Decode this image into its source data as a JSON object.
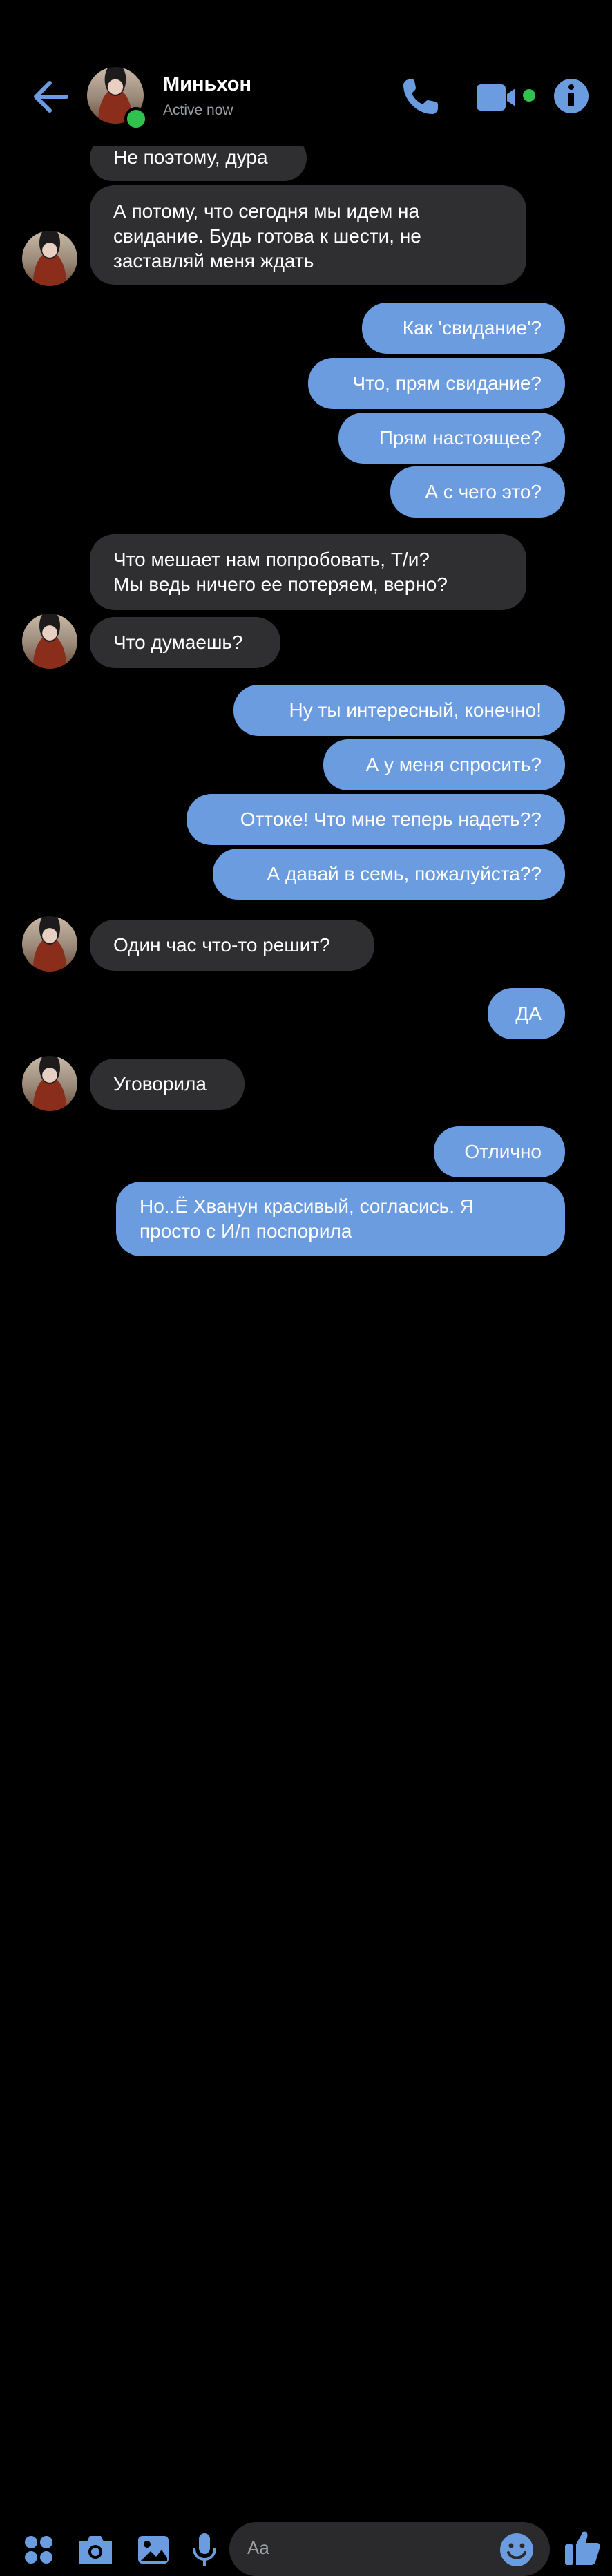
{
  "header": {
    "name": "Миньхон",
    "status": "Active now"
  },
  "messages": [
    {
      "side": "in",
      "text": "Не поэтому, дура"
    },
    {
      "side": "in",
      "text": "А потому, что сегодня мы идем на\nсвидание. Будь готова к шести, не\nзаставляй меня ждать"
    },
    {
      "side": "out",
      "text": "Как 'свидание'?"
    },
    {
      "side": "out",
      "text": "Что, прям свидание?"
    },
    {
      "side": "out",
      "text": "Прям настоящее?"
    },
    {
      "side": "out",
      "text": "А с чего это?"
    },
    {
      "side": "in",
      "text": "Что мешает нам попробовать, Т/и?\nМы ведь ничего ее потеряем, верно?"
    },
    {
      "side": "in",
      "text": "Что думаешь?"
    },
    {
      "side": "out",
      "text": "Ну ты интересный, конечно!"
    },
    {
      "side": "out",
      "text": "А у меня спросить?"
    },
    {
      "side": "out",
      "text": "Оттоке! Что мне теперь надеть??"
    },
    {
      "side": "out",
      "text": "А давай в семь, пожалуйста??"
    },
    {
      "side": "in",
      "text": "Один час что-то решит?"
    },
    {
      "side": "out",
      "text": "ДА"
    },
    {
      "side": "in",
      "text": "Уговорила"
    },
    {
      "side": "out",
      "text": "Отлично"
    },
    {
      "side": "out",
      "text": "Но..Ё Хванун красивый, согласись. Я\nпросто с И/п поспорила"
    }
  ],
  "composer": {
    "placeholder": "Aa"
  },
  "colors": {
    "accent": "#6b9ce0",
    "incoming_bubble": "#2f2f31",
    "online": "#31c24d"
  },
  "icons": [
    "back-arrow-icon",
    "phone-icon",
    "video-camera-icon",
    "info-icon",
    "apps-grid-icon",
    "camera-icon",
    "gallery-icon",
    "microphone-icon",
    "emoji-icon",
    "thumbs-up-icon"
  ]
}
